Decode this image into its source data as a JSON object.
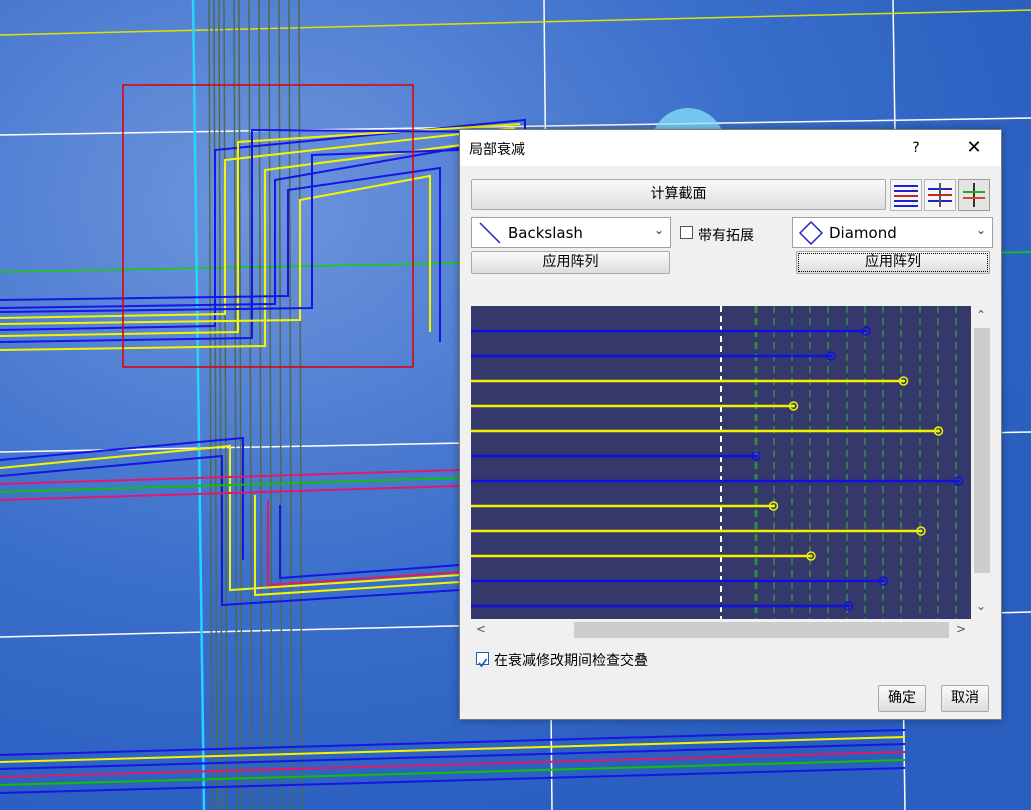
{
  "canvas": {
    "background": "#2f66c7",
    "selection_color": "#e00000"
  },
  "dialog": {
    "title": "局部衰减",
    "help_label": "?",
    "close_label": "✕",
    "compute_label": "计算截面",
    "left_combo": {
      "value": "Backslash",
      "icon": "backslash-icon"
    },
    "extension_label": "带有拓展",
    "extension_checked": false,
    "right_combo": {
      "value": "Diamond",
      "icon": "diamond-icon"
    },
    "apply_left_label": "应用阵列",
    "apply_right_label": "应用阵列",
    "check_overlap_label": "在衰减修改期间检查交叠",
    "check_overlap_checked": true,
    "ok_label": "确定",
    "cancel_label": "取消",
    "view_icons": [
      "lines-view-icon",
      "crossed-lines-view-icon",
      "single-line-view-icon"
    ]
  },
  "section_view": {
    "background": "#34386a",
    "traces": [
      {
        "color": "blue",
        "end": 0.79
      },
      {
        "color": "blue",
        "end": 0.72
      },
      {
        "color": "yellow",
        "end": 0.865
      },
      {
        "color": "yellow",
        "end": 0.645
      },
      {
        "color": "yellow",
        "end": 0.935
      },
      {
        "color": "blue",
        "end": 0.57
      },
      {
        "color": "blue",
        "end": 0.975
      },
      {
        "color": "yellow",
        "end": 0.605
      },
      {
        "color": "yellow",
        "end": 0.9
      },
      {
        "color": "yellow",
        "end": 0.68
      },
      {
        "color": "blue",
        "end": 0.825
      },
      {
        "color": "blue",
        "end": 0.755
      }
    ],
    "colors": {
      "blue": "#1010e6",
      "yellow": "#f2f200"
    }
  }
}
